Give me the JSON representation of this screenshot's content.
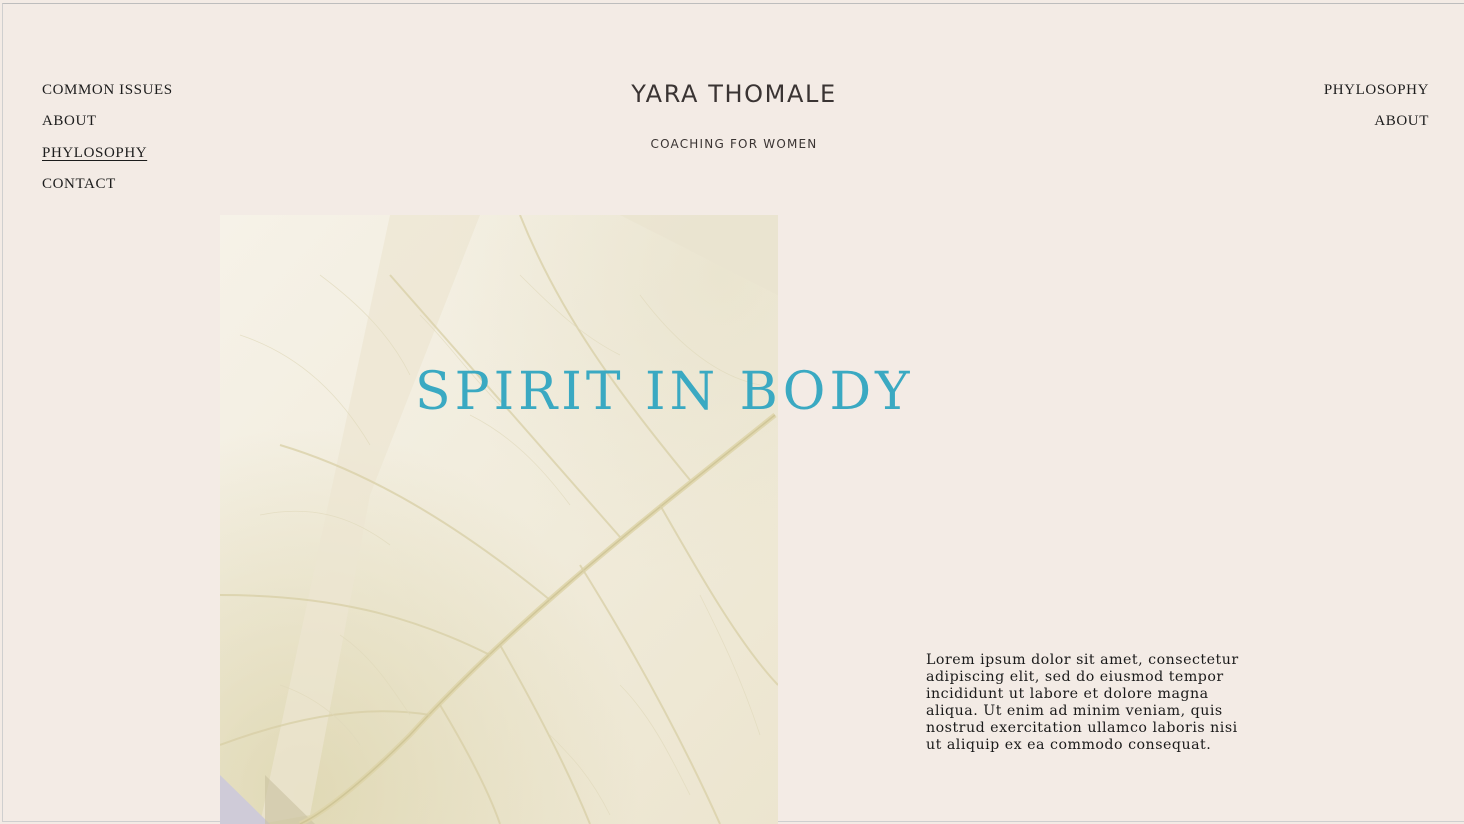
{
  "nav_left": {
    "items": [
      {
        "label": "COMMON ISSUES"
      },
      {
        "label": "ABOUT"
      },
      {
        "label": "PHYLOSOPHY"
      },
      {
        "label": "CONTACT"
      }
    ],
    "active_label": "PHYLOSOPHY"
  },
  "nav_right": {
    "items": [
      {
        "label": "PHYLOSOPHY"
      },
      {
        "label": "ABOUT"
      }
    ]
  },
  "header": {
    "brand": "YARA THOMALE",
    "tagline": "COACHING FOR WOMEN"
  },
  "hero": {
    "title": "SPIRIT IN BODY",
    "image": "leaf-photo"
  },
  "intro": {
    "text": "Lorem ipsum dolor sit amet, consectetur adipiscing elit, sed do eiusmod tempor incididunt ut labore et dolore magna aliqua. Ut enim ad minim veniam, quis nostrud exercitation ullamco laboris nisi ut aliquip ex ea commodo consequat."
  },
  "colors": {
    "background": "#f3ebe5",
    "accent": "#3aa9c2",
    "text": "#1c1c1c"
  }
}
